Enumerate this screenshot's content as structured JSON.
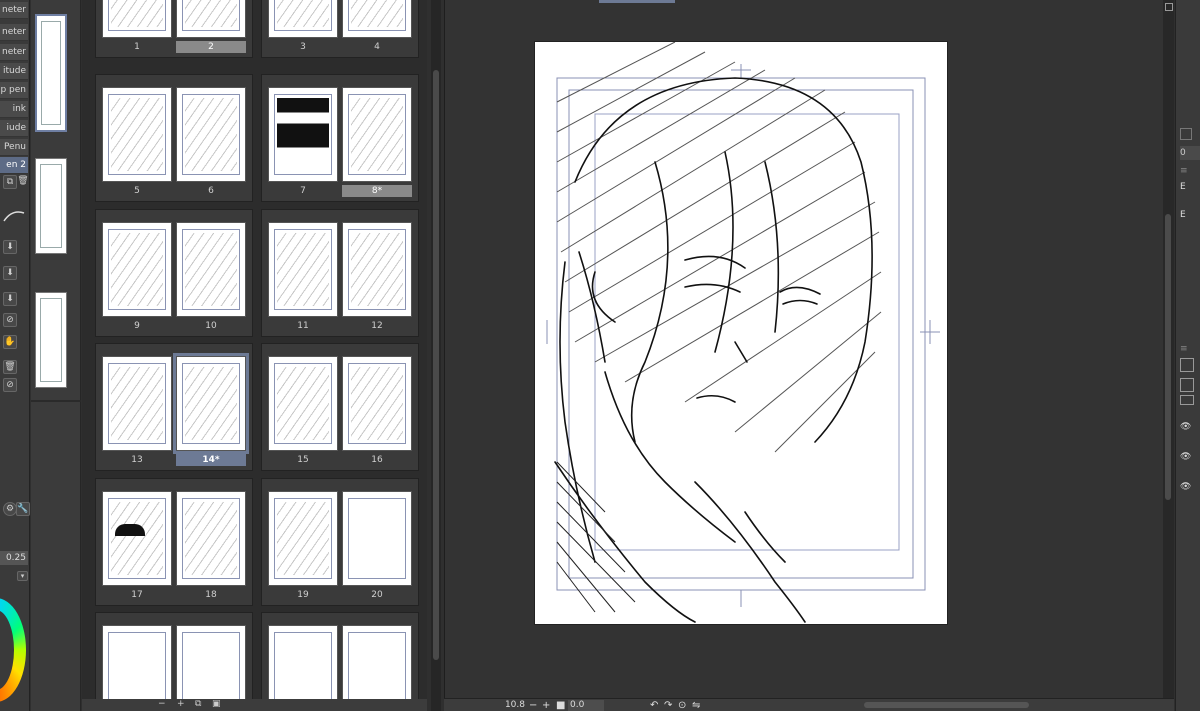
{
  "tool_panel": {
    "subtools": [
      {
        "label": "neter",
        "active": false
      },
      {
        "label": "neter",
        "active": false
      },
      {
        "label": "itude",
        "active": false
      },
      {
        "label": "p pen",
        "active": false
      },
      {
        "label": "ink",
        "active": false
      },
      {
        "label": "iude",
        "active": false
      },
      {
        "label": "Penu",
        "active": false
      },
      {
        "label": "en 2",
        "active": true
      }
    ],
    "brush_size": "0.25"
  },
  "page_manager": {
    "pages": [
      {
        "num": "1"
      },
      {
        "num": "2"
      },
      {
        "num": "3"
      },
      {
        "num": "4"
      },
      {
        "num": "5"
      },
      {
        "num": "6"
      },
      {
        "num": "7"
      },
      {
        "num": "8*"
      },
      {
        "num": "9"
      },
      {
        "num": "10"
      },
      {
        "num": "11"
      },
      {
        "num": "12"
      },
      {
        "num": "13"
      },
      {
        "num": "14*"
      },
      {
        "num": "15"
      },
      {
        "num": "16"
      },
      {
        "num": "17"
      },
      {
        "num": "18"
      },
      {
        "num": "19"
      },
      {
        "num": "20"
      },
      {
        "num": ""
      },
      {
        "num": ""
      },
      {
        "num": ""
      },
      {
        "num": ""
      }
    ],
    "selected_page": "14*"
  },
  "status_bar": {
    "zoom": "10.8",
    "rotation": "0.0"
  },
  "right_panel": {
    "items": [
      "E",
      "E"
    ]
  }
}
